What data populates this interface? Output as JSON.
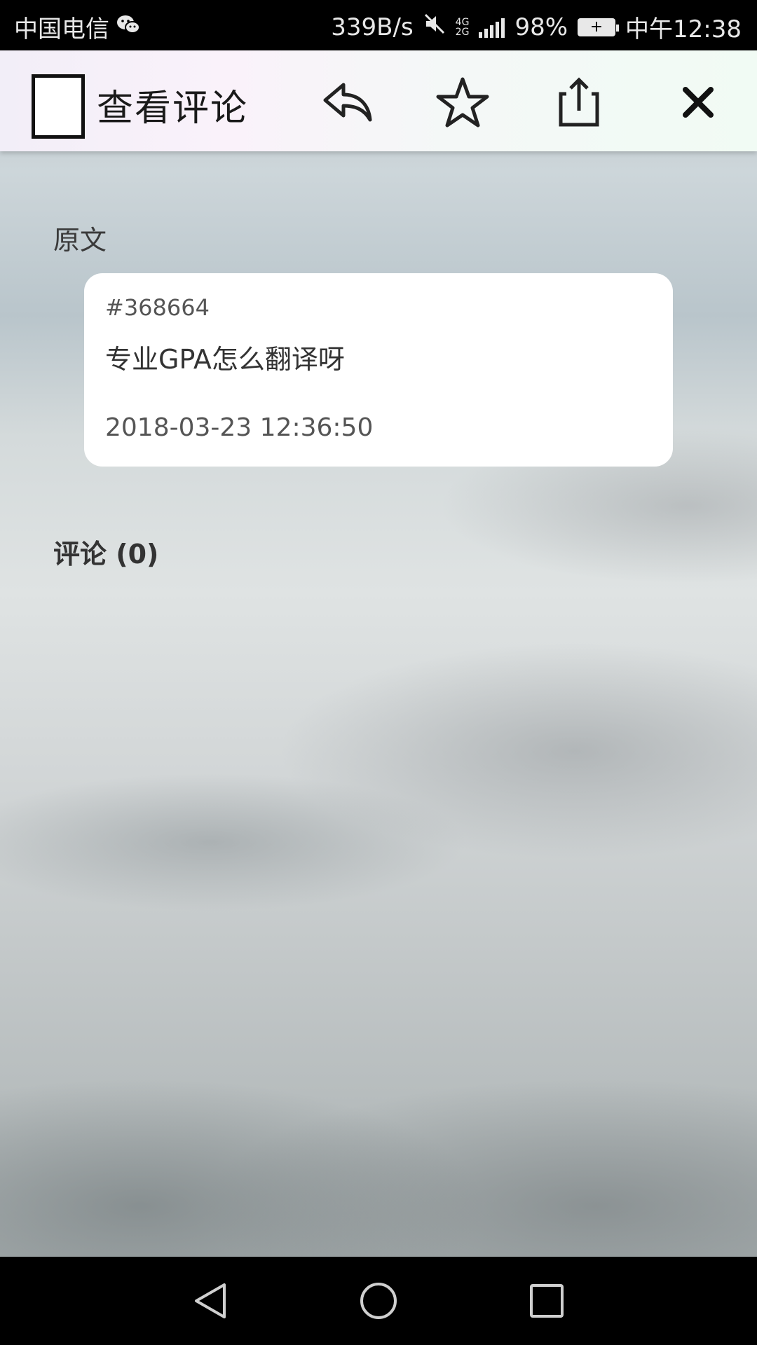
{
  "status_bar": {
    "carrier": "中国电信",
    "net_speed": "339B/s",
    "net_type_top": "4G",
    "net_type_bottom": "2G",
    "battery_percent": "98%",
    "time": "中午12:38",
    "icons": [
      "wechat-icon",
      "mute-icon",
      "signal-icon",
      "battery-charging-icon"
    ]
  },
  "app_bar": {
    "title": "查看评论",
    "actions": [
      "reply-icon",
      "star-icon",
      "share-icon",
      "close-icon"
    ]
  },
  "original": {
    "label": "原文",
    "post_id": "#368664",
    "content": "专业GPA怎么翻译呀",
    "timestamp": "2018-03-23 12:36:50"
  },
  "comments": {
    "label": "评论 (0)"
  },
  "nav_bar": {
    "buttons": [
      "back-triangle-icon",
      "home-circle-icon",
      "recents-square-icon"
    ]
  },
  "colors": {
    "app_bar_bg": "#f5f4f8",
    "card_bg": "#ffffff",
    "status_bar_bg": "#000000"
  }
}
